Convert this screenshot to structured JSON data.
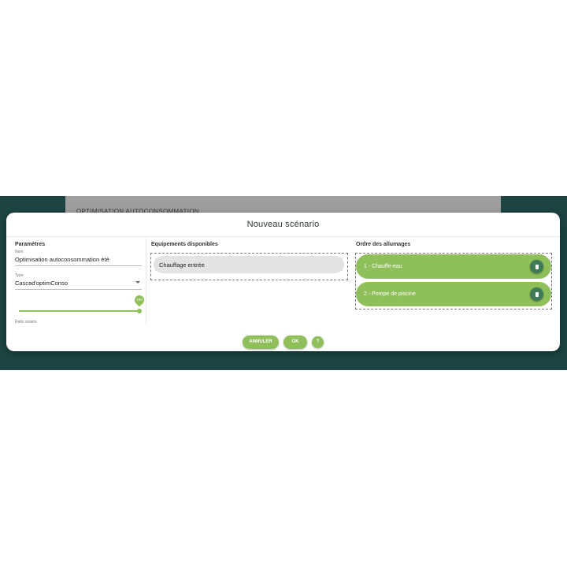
{
  "background": {
    "panel_title": "OPTIMISATION AUTOCONSOMMATION"
  },
  "dialog": {
    "title": "Nouveau scénario"
  },
  "params": {
    "section_title": "Paramètres",
    "name_label": "Nom",
    "name_value": "Optimisation autoconsommation été",
    "type_label": "Type",
    "type_value": "Cascad'optimConso",
    "slider_value": "100",
    "slider_fraction": 1.0,
    "slider_label": "Ratio solaire"
  },
  "equipments": {
    "section_title": "Equipements disponibles",
    "items": [
      {
        "label": "Chauffage entrée"
      }
    ]
  },
  "order": {
    "section_title": "Ordre des allumages",
    "items": [
      {
        "label": "1 - Chauffe-eau"
      },
      {
        "label": "2 - Pompe de piscine"
      }
    ]
  },
  "footer": {
    "cancel_label": "ANNULER",
    "ok_label": "OK",
    "help_label": "?"
  },
  "colors": {
    "accent": "#8fbf5a",
    "backdrop": "#1c4441",
    "delete_button": "#3d7a55"
  },
  "icons": {
    "delete": "trash-icon",
    "select": "chevron-down-icon"
  }
}
